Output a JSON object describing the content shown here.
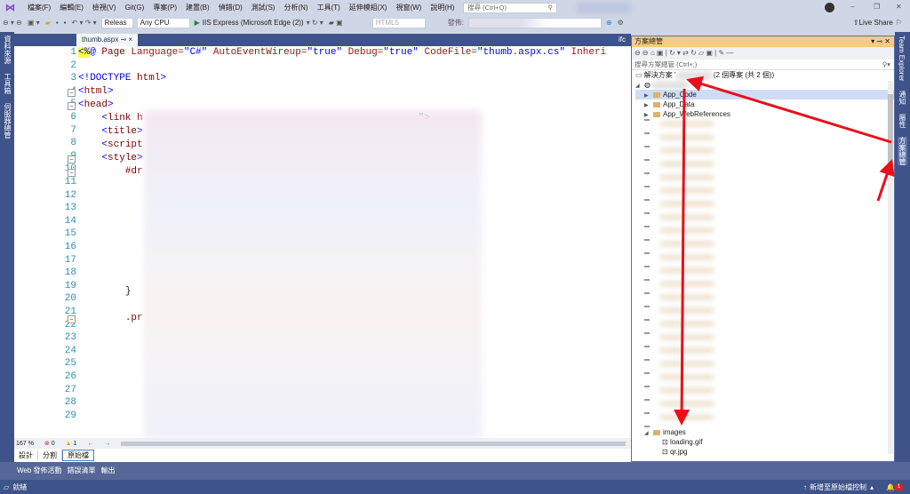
{
  "menubar": {
    "items": [
      "檔案(F)",
      "編輯(E)",
      "檢視(V)",
      "Git(G)",
      "專案(P)",
      "建置(B)",
      "偵錯(D)",
      "測試(S)",
      "分析(N)",
      "工具(T)",
      "延伸模組(X)",
      "視窗(W)",
      "說明(H)"
    ],
    "search_placeholder": "搜尋 (Ctrl+Q)"
  },
  "window_controls": {
    "minimize": "–",
    "restore": "❐",
    "close": "✕"
  },
  "toolbar": {
    "config": "Releas",
    "platform": "Any CPU",
    "run": "IIS Express (Microsoft Edge (2))",
    "html": "HTML5",
    "publish_label": "發佈:",
    "live_share": "Live Share"
  },
  "left_strip": [
    "資料來源",
    "工具箱",
    "伺服器總管"
  ],
  "right_strip": [
    "Team Explorer",
    "通知",
    "屬性",
    "方案總管"
  ],
  "tabs": {
    "active": "thumb.aspx",
    "pin": "⊸",
    "close": "×",
    "overflow": "ifc"
  },
  "editor": {
    "line_numbers": [
      "1",
      "2",
      "3",
      "4",
      "5",
      "6",
      "7",
      "8",
      "9",
      "10",
      "11",
      "12",
      "13",
      "14",
      "15",
      "16",
      "17",
      "18",
      "19",
      "20",
      "21",
      "22",
      "23",
      "24",
      "25",
      "26",
      "27",
      "28",
      "29"
    ],
    "line1": {
      "open": "<%",
      "at": "@",
      "page": " Page ",
      "lang_attr": "Language=",
      "lang_val": "\"C#\"",
      "aew_attr": " AutoEventWireup=",
      "aew_val": "\"true\"",
      "dbg_attr": " Debug=",
      "dbg_val": "\"true\"",
      "cf_attr": " CodeFile=",
      "cf_val": "\"thumb.aspx.cs\"",
      "inh": " Inheri"
    },
    "doctype_open": "<!DOCTYPE ",
    "doctype_html": "html",
    "doctype_close": ">",
    "html_tag": "html",
    "head_tag": "head",
    "link_tag": "link",
    "link_rest": " h",
    "link_end": "\">",
    "title_tag": "title",
    "script_tag": "script",
    "style_tag": "style",
    "sel1": "#dr",
    "close_brace": "}",
    "sel2": ".pr"
  },
  "editor_status": {
    "zoom": "167 %",
    "errors": "0",
    "warnings": "1"
  },
  "view_tabs": [
    "設計",
    "分割",
    "原始檔"
  ],
  "bottom_tabs": [
    "Web 發佈活動",
    "錯誤清單",
    "輸出"
  ],
  "status": {
    "ready": "就緒",
    "source_control": "新增至原始檔控制",
    "notifications": "1"
  },
  "solution_explorer": {
    "title": "方案總管",
    "search_placeholder": "搜尋方案總管 (Ctrl+;)",
    "solution_label": "解決方案 '",
    "solution_count": "(2 個專案 (共 2 個))",
    "items": [
      "App_Code",
      "App_Data",
      "App_WebReferences"
    ],
    "images_folder": "images",
    "files": [
      "loading.gif",
      "qr.jpg"
    ]
  }
}
